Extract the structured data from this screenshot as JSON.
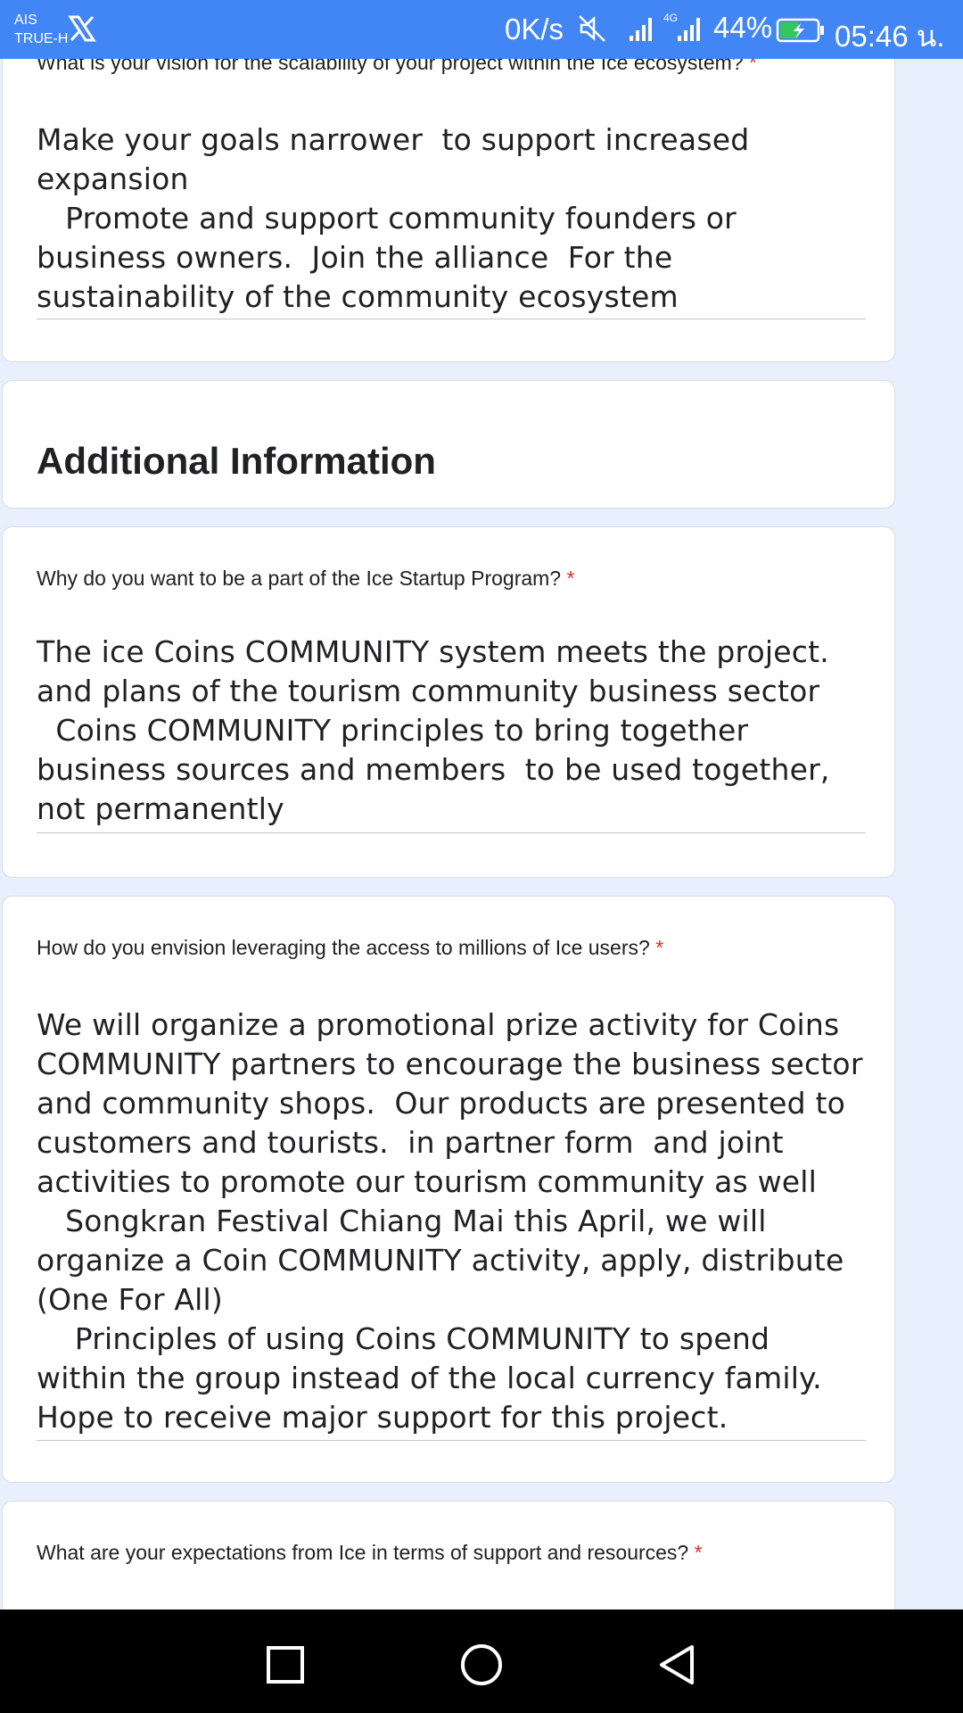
{
  "status_bar": {
    "carrier_line1": "AIS",
    "carrier_line2": "TRUE-H",
    "net_speed": "0K/s",
    "network_type": "4G",
    "battery": "44%",
    "time": "05:46 น."
  },
  "cards": {
    "vision": {
      "question": "What is your vision for the scalability of your project within the Ice ecosystem?",
      "required": "*",
      "answer": "Make your goals narrower  to support increased expansion\n   Promote and support community founders or business owners.  Join the alliance  For the sustainability of the community ecosystem"
    },
    "section": {
      "title": "Additional Information"
    },
    "why": {
      "question": "Why do you want to be a part of the Ice Startup Program?",
      "required": "*",
      "answer": "The ice Coins COMMUNITY system meets the project. and plans of the tourism community business sector\n  Coins COMMUNITY principles to bring together business sources and members  to be used together, not permanently"
    },
    "leverage": {
      "question": "How do you envision leveraging the access to millions of Ice users?",
      "required": "*",
      "answer": "We will organize a promotional prize activity for Coins COMMUNITY partners to encourage the business sector and community shops.  Our products are presented to customers and tourists.  in partner form  and joint activities to promote our tourism community as well\n   Songkran Festival Chiang Mai this April, we will organize a Coin COMMUNITY activity, apply, distribute (One For All)\n    Principles of using Coins COMMUNITY to spend within the group instead of the local currency family.  Hope to receive major support for this project."
    },
    "expectations": {
      "question": "What are your expectations from Ice in terms of support and resources?",
      "required": "*"
    }
  },
  "icons": {
    "x_logo": "x-logo-icon",
    "mute": "mute-icon",
    "signal": "signal-icon",
    "battery": "battery-charging-icon",
    "recents": "square-icon",
    "home": "circle-icon",
    "back": "triangle-back-icon"
  },
  "colors": {
    "status_bar": "#4285f4",
    "page_background": "#e8effd",
    "required": "#d93025",
    "nav_bar": "#000000"
  }
}
